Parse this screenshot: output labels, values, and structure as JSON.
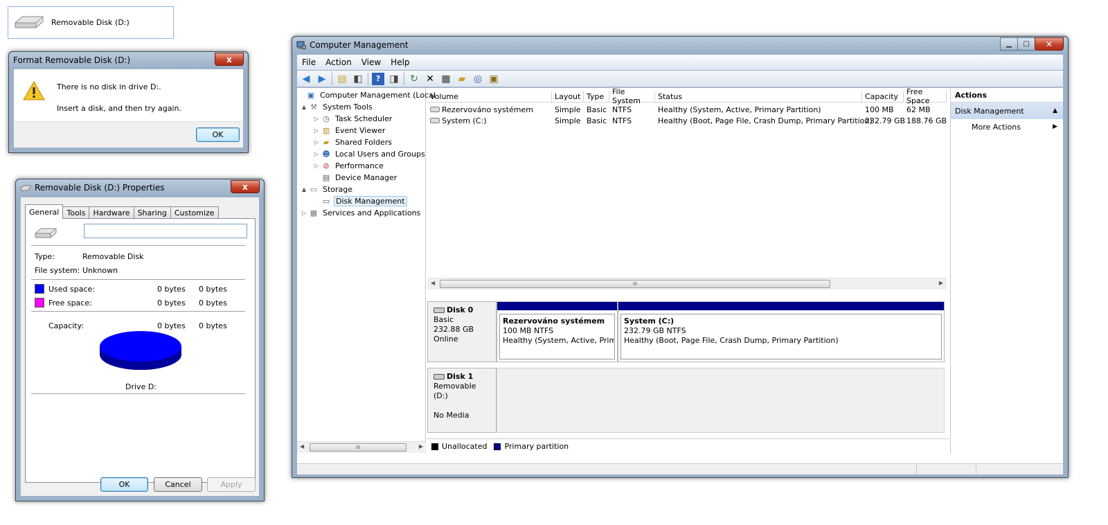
{
  "disk_tile": {
    "label": "Removable Disk (D:)"
  },
  "format_dialog": {
    "title": "Format Removable Disk (D:)",
    "message_line1": "There is no disk in drive D:.",
    "message_line2": "Insert a disk, and then try again.",
    "ok_label": "OK",
    "close_glyph": "x"
  },
  "properties_dialog": {
    "title": "Removable Disk (D:) Properties",
    "tabs": [
      "General",
      "Tools",
      "Hardware",
      "Sharing",
      "Customize"
    ],
    "name_value": "",
    "type_label": "Type:",
    "type_value": "Removable Disk",
    "fs_label": "File system:",
    "fs_value": "Unknown",
    "used_label": "Used space:",
    "used_bytes": "0 bytes",
    "used_bytes2": "0 bytes",
    "free_label": "Free space:",
    "free_bytes": "0 bytes",
    "free_bytes2": "0 bytes",
    "capacity_label": "Capacity:",
    "capacity_bytes": "0 bytes",
    "capacity_bytes2": "0 bytes",
    "drive_label": "Drive D:",
    "ok_label": "OK",
    "cancel_label": "Cancel",
    "apply_label": "Apply",
    "used_color": "#0000ff",
    "free_color": "#ff00ff",
    "close_glyph": "x"
  },
  "computer_management": {
    "title": "Computer Management",
    "menu": [
      "File",
      "Action",
      "View",
      "Help"
    ],
    "toolbar_icons": [
      "back-arrow-icon",
      "forward-arrow-icon",
      "up-folder-icon",
      "show-hide-tree-icon",
      "help-icon",
      "show-hide-action-pane-icon",
      "refresh-icon",
      "delete-icon",
      "properties-icon",
      "open-folder-icon",
      "search-icon",
      "export-icon"
    ],
    "tree": [
      {
        "label": "Computer Management (Local",
        "level": 0,
        "expander": ""
      },
      {
        "label": "System Tools",
        "level": 1,
        "expander": "▲"
      },
      {
        "label": "Task Scheduler",
        "level": 2,
        "expander": "▷"
      },
      {
        "label": "Event Viewer",
        "level": 2,
        "expander": "▷"
      },
      {
        "label": "Shared Folders",
        "level": 2,
        "expander": "▷"
      },
      {
        "label": "Local Users and Groups",
        "level": 2,
        "expander": "▷"
      },
      {
        "label": "Performance",
        "level": 2,
        "expander": "▷"
      },
      {
        "label": "Device Manager",
        "level": 2,
        "expander": ""
      },
      {
        "label": "Storage",
        "level": 1,
        "expander": "▲"
      },
      {
        "label": "Disk Management",
        "level": 2,
        "expander": ""
      },
      {
        "label": "Services and Applications",
        "level": 1,
        "expander": "▷"
      }
    ],
    "columns": [
      "Volume",
      "Layout",
      "Type",
      "File System",
      "Status",
      "Capacity",
      "Free Space"
    ],
    "volumes": [
      [
        "Rezervováno systémem",
        "Simple",
        "Basic",
        "NTFS",
        "Healthy (System, Active, Primary Partition)",
        "100 MB",
        "62 MB"
      ],
      [
        "System (C:)",
        "Simple",
        "Basic",
        "NTFS",
        "Healthy (Boot, Page File, Crash Dump, Primary Partition)",
        "232.79 GB",
        "188.76 GB"
      ]
    ],
    "scroll_grip": "III",
    "disk0": {
      "name": "Disk 0",
      "type": "Basic",
      "size": "232.88 GB",
      "state": "Online",
      "partitions": [
        {
          "name": "Rezervováno systémem",
          "size": "100 MB NTFS",
          "status": "Healthy (System, Active, Primar"
        },
        {
          "name": "System  (C:)",
          "size": "232.79 GB NTFS",
          "status": "Healthy (Boot, Page File, Crash Dump, Primary Partition)"
        }
      ]
    },
    "disk1": {
      "name": "Disk 1",
      "type": "Removable (D:)",
      "state": "No Media"
    },
    "legend": [
      {
        "label": "Unallocated",
        "color": "#000000"
      },
      {
        "label": "Primary partition",
        "color": "#00008b"
      }
    ],
    "actions": {
      "header": "Actions",
      "selected": "Disk Management",
      "more": "More Actions"
    }
  }
}
